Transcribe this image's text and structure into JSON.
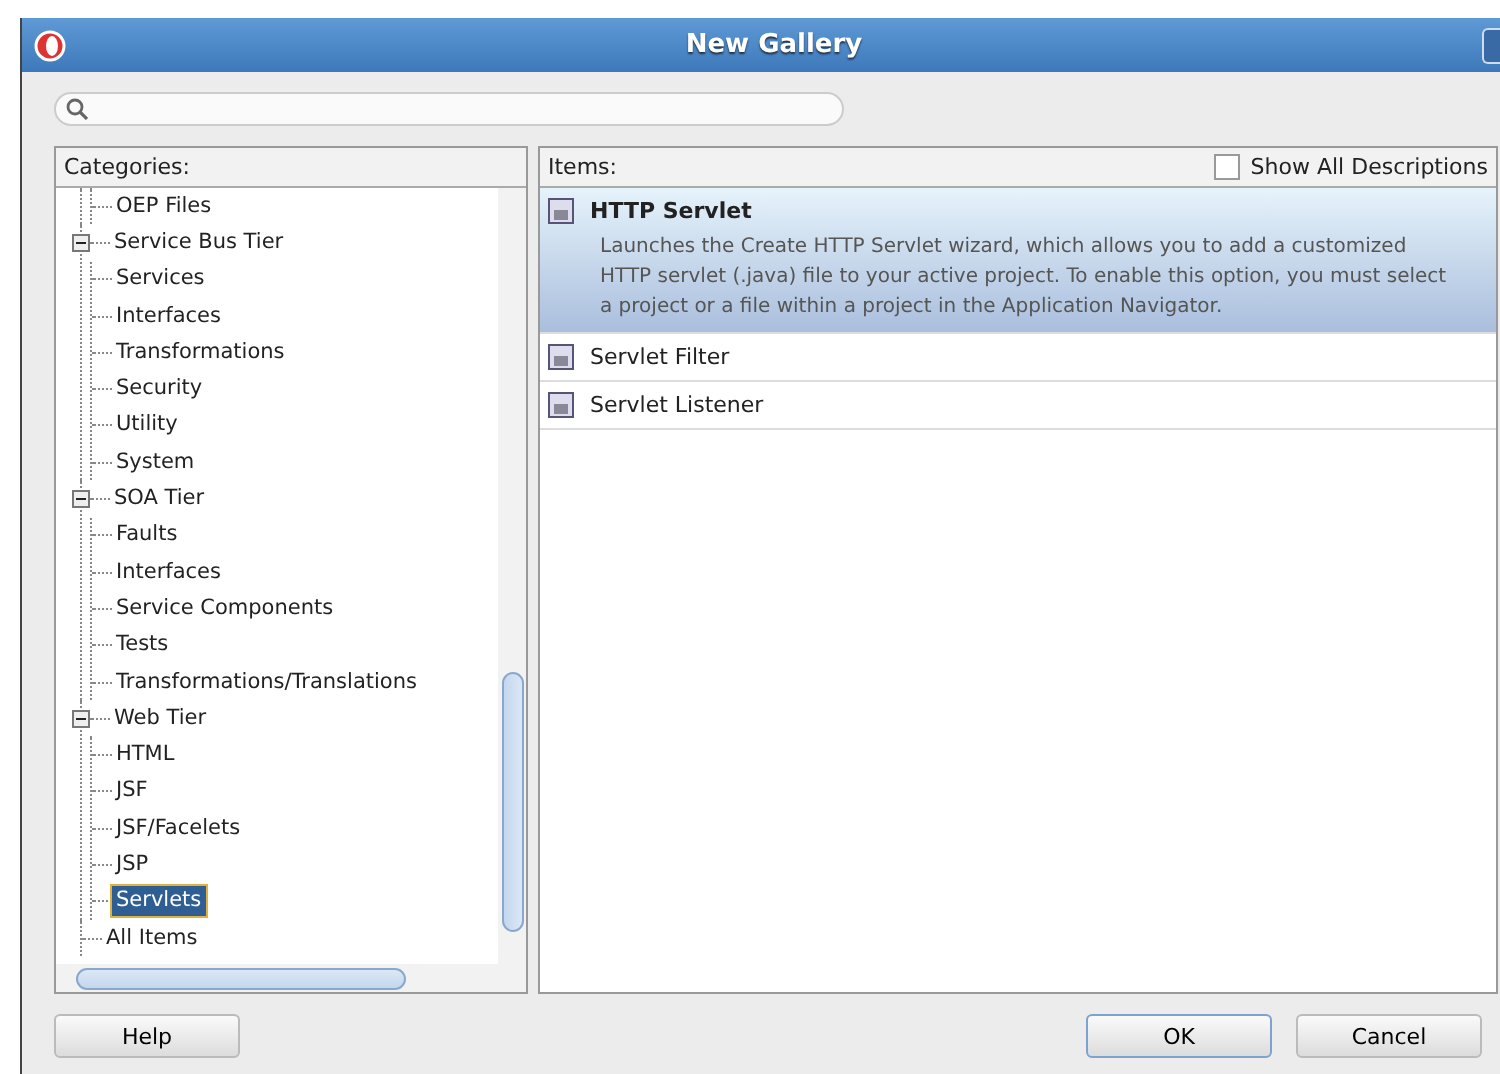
{
  "window": {
    "title": "New Gallery"
  },
  "categories": {
    "label": "Categories:",
    "nodes": [
      {
        "children": [
          {
            "label": "OEP Files",
            "selected": false
          }
        ]
      },
      {
        "label": "Service Bus Tier",
        "expanded": true,
        "selected": false,
        "children": [
          {
            "label": "Services",
            "selected": false
          },
          {
            "label": "Interfaces",
            "selected": false
          },
          {
            "label": "Transformations",
            "selected": false
          },
          {
            "label": "Security",
            "selected": false
          },
          {
            "label": "Utility",
            "selected": false
          },
          {
            "label": "System",
            "selected": false
          }
        ]
      },
      {
        "label": "SOA Tier",
        "expanded": true,
        "selected": false,
        "children": [
          {
            "label": "Faults",
            "selected": false
          },
          {
            "label": "Interfaces",
            "selected": false
          },
          {
            "label": "Service Components",
            "selected": false
          },
          {
            "label": "Tests",
            "selected": false
          },
          {
            "label": "Transformations/Translations",
            "selected": false
          }
        ]
      },
      {
        "label": "Web Tier",
        "expanded": true,
        "selected": false,
        "children": [
          {
            "label": "HTML",
            "selected": false
          },
          {
            "label": "JSF",
            "selected": false
          },
          {
            "label": "JSF/Facelets",
            "selected": false
          },
          {
            "label": "JSP",
            "selected": false
          },
          {
            "label": "Servlets",
            "selected": true
          }
        ]
      },
      {
        "label": "All Items",
        "selected": false
      }
    ]
  },
  "items": {
    "label": "Items:",
    "show_all_descriptions": {
      "label": "Show All Descriptions",
      "checked": false
    },
    "list": [
      {
        "name": "HTTP Servlet",
        "selected": true,
        "description": "Launches the Create HTTP Servlet wizard, which allows you to add a customized HTTP servlet (.java) file to your active project. To enable this option, you must select a project or a file within a project in the Application Navigator."
      },
      {
        "name": "Servlet Filter",
        "selected": false
      },
      {
        "name": "Servlet Listener",
        "selected": false
      }
    ]
  },
  "buttons": [
    {
      "label": "Help",
      "default": false
    },
    {
      "label": "OK",
      "default": true
    },
    {
      "label": "Cancel",
      "default": false
    }
  ]
}
